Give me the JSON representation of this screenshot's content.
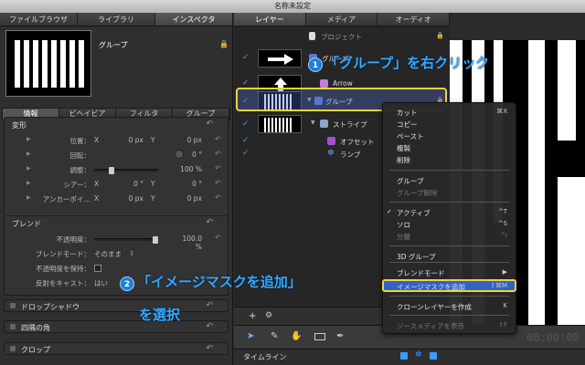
{
  "window": {
    "title": "名称未設定"
  },
  "left": {
    "tabs": [
      "ファイルブラウザ",
      "ライブラリ",
      "インスペクタ"
    ],
    "preview_label": "グループ",
    "subtabs": [
      "情報",
      "ビヘイビア",
      "フィルタ",
      "グループ"
    ],
    "transform": {
      "title": "変形",
      "rows": [
        {
          "label": "位置：",
          "k1": "X",
          "v1": "0 px",
          "k2": "Y",
          "v2": "0 px"
        },
        {
          "label": "回転：",
          "k1": "",
          "v1": "",
          "k2": "",
          "v2": "0 °"
        },
        {
          "label": "調整：",
          "k1": "",
          "v1": "",
          "k2": "",
          "v2": "100 %"
        },
        {
          "label": "シアー：",
          "k1": "X",
          "v1": "0 °",
          "k2": "Y",
          "v2": "0 °"
        },
        {
          "label": "アンカーポイ…",
          "k1": "X",
          "v1": "0 px",
          "k2": "Y",
          "v2": "0 px"
        }
      ]
    },
    "blend": {
      "title": "ブレンド",
      "opacity_label": "不透明度：",
      "opacity_value": "100.0 %",
      "opacity_level": 1.0,
      "mode_label": "ブレンドモード：",
      "mode_value": "そのまま",
      "preserve_label": "不透明度を保持：",
      "shadow_label": "反射をキャスト：",
      "shadow_value": "はい"
    },
    "collapsed": [
      "ドロップシャドウ",
      "四隅の角",
      "クロップ"
    ]
  },
  "middle": {
    "tabs": [
      "レイヤー",
      "メディア",
      "オーディオ"
    ],
    "layers": {
      "project": "プロジェクト",
      "group_inner": "グループ",
      "arrow": "Arrow",
      "group": "グループ",
      "stripe": "ストライプ",
      "offset": "オフセット",
      "random": "ランプ"
    },
    "bottom_buttons": [
      "+",
      "⚙"
    ]
  },
  "menu": {
    "items": [
      {
        "label": "カット",
        "shortcut": "⌘X",
        "dim": false
      },
      {
        "label": "コピー",
        "shortcut": "",
        "dim": false
      },
      {
        "label": "ペースト",
        "shortcut": "",
        "dim": false
      },
      {
        "label": "複製",
        "shortcut": "",
        "dim": false
      },
      {
        "label": "削除",
        "shortcut": "",
        "dim": false
      },
      {
        "label": "グループ",
        "shortcut": "",
        "dim": false
      },
      {
        "label": "グループ解除",
        "shortcut": "",
        "dim": true
      },
      {
        "label": "アクティブ",
        "shortcut": "^T",
        "dim": false,
        "checked": true
      },
      {
        "label": "ソロ",
        "shortcut": "^S",
        "dim": false
      },
      {
        "label": "分離",
        "shortcut": "^I",
        "dim": true
      },
      {
        "label": "3D グループ",
        "shortcut": "",
        "dim": false
      },
      {
        "label": "ブレンドモード",
        "shortcut": "▶",
        "dim": false
      },
      {
        "label": "イメージマスクを追加",
        "shortcut": "⇧⌘M",
        "dim": false
      },
      {
        "label": "クローンレイヤーを作成",
        "shortcut": "K",
        "dim": false
      },
      {
        "label": "ソースメディアを表示",
        "shortcut": "⇧F",
        "dim": true
      }
    ]
  },
  "toolbar": {
    "timecode": "00:00:00",
    "timeline_label": "タイムライン"
  },
  "annotations": {
    "step1_num": "1",
    "step1_text": "「グループ」を右クリック",
    "step2_num": "2",
    "step2_text": "「イメージマスクを追加」",
    "step2_text2": "を選択"
  },
  "colors": {
    "highlight": "#f2d23c",
    "accent": "#35a7ff",
    "selection": "#2f63c6"
  }
}
